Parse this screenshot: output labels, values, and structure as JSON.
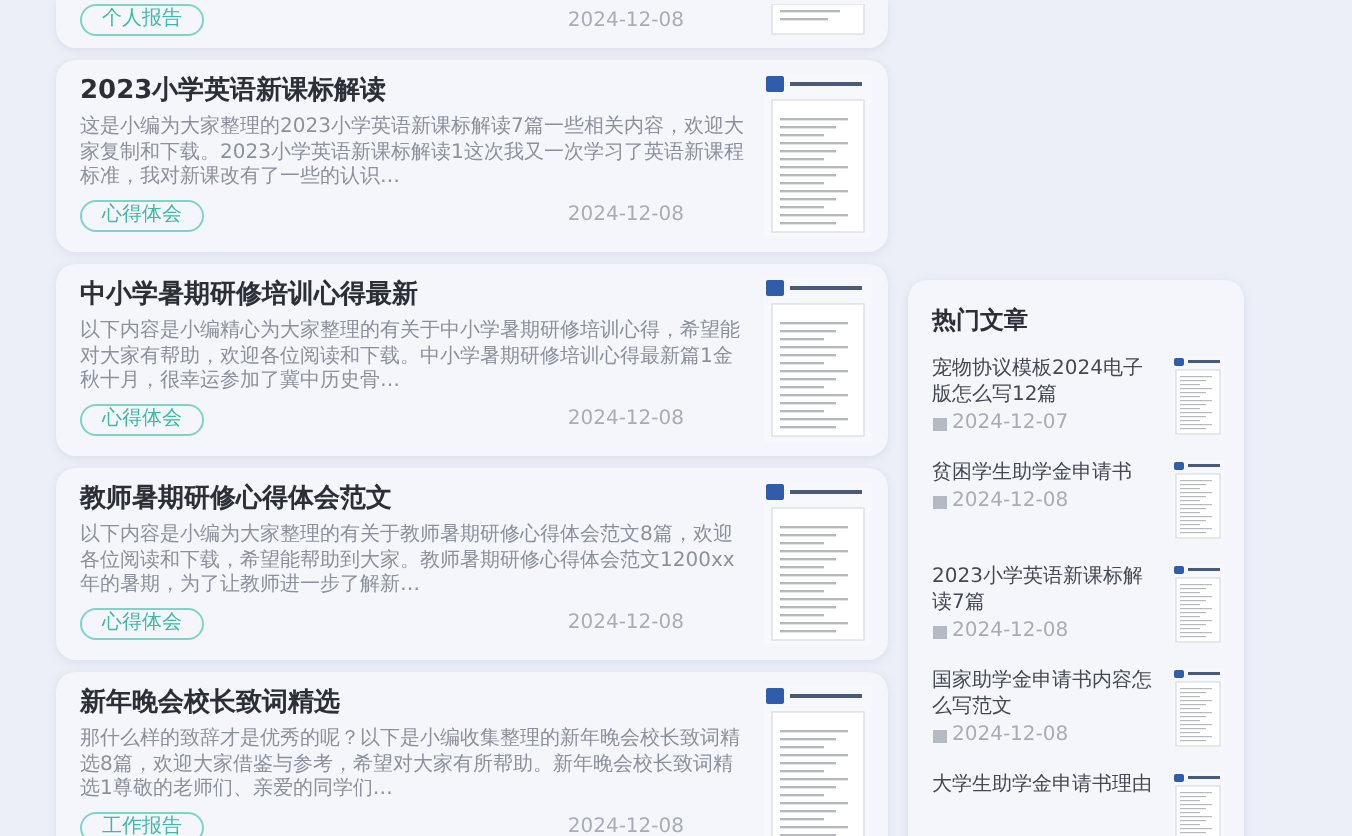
{
  "partial_card": {
    "tag": "个人报告",
    "date": "2024-12-08"
  },
  "articles": [
    {
      "title": "2023小学英语新课标解读",
      "summary": "这是小编为大家整理的2023小学英语新课标解读7篇一些相关内容，欢迎大家复制和下载。2023小学英语新课标解读1这次我又一次学习了英语新课程标准，我对新课改有了一些的认识…",
      "tag": "心得体会",
      "date": "2024-12-08"
    },
    {
      "title": "中小学暑期研修培训心得最新",
      "summary": "以下内容是小编精心为大家整理的有关于中小学暑期研修培训心得，希望能对大家有帮助，欢迎各位阅读和下载。中小学暑期研修培训心得最新篇1金秋十月，很幸运参加了冀中历史骨…",
      "tag": "心得体会",
      "date": "2024-12-08"
    },
    {
      "title": "教师暑期研修心得体会范文",
      "summary": "以下内容是小编为大家整理的有关于教师暑期研修心得体会范文8篇，欢迎各位阅读和下载，希望能帮助到大家。教师暑期研修心得体会范文1200xx年的暑期，为了让教师进一步了解新…",
      "tag": "心得体会",
      "date": "2024-12-08"
    },
    {
      "title": "新年晚会校长致词精选",
      "summary": "那什么样的致辞才是优秀的呢？以下是小编收集整理的新年晚会校长致词精选8篇，欢迎大家借鉴与参考，希望对大家有所帮助。新年晚会校长致词精选1尊敬的老师们、亲爱的同学们…",
      "tag": "工作报告",
      "date": "2024-12-08"
    }
  ],
  "sidebar": {
    "title": "热门文章",
    "items": [
      {
        "title": "宠物协议模板2024电子版怎么写12篇",
        "date": "2024-12-07"
      },
      {
        "title": "贫困学生助学金申请书",
        "date": "2024-12-08"
      },
      {
        "title": "2023小学英语新课标解读7篇",
        "date": "2024-12-08"
      },
      {
        "title": "国家助学金申请书内容怎么写范文",
        "date": "2024-12-08"
      },
      {
        "title": "大学生助学金申请书理由"
      }
    ]
  }
}
